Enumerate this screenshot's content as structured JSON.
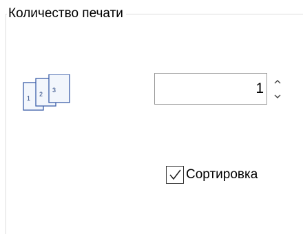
{
  "group": {
    "title": "Количество печати"
  },
  "copies_icon": {
    "pages": [
      "1",
      "2",
      "3"
    ]
  },
  "copies": {
    "value": "1"
  },
  "collate": {
    "label": "Сортировка",
    "checked": true
  },
  "colors": {
    "page_border": "#3b5ea8",
    "page_fill": "#f2f6fc",
    "checkbox_border": "#333333",
    "input_border": "#9a9a9a"
  }
}
